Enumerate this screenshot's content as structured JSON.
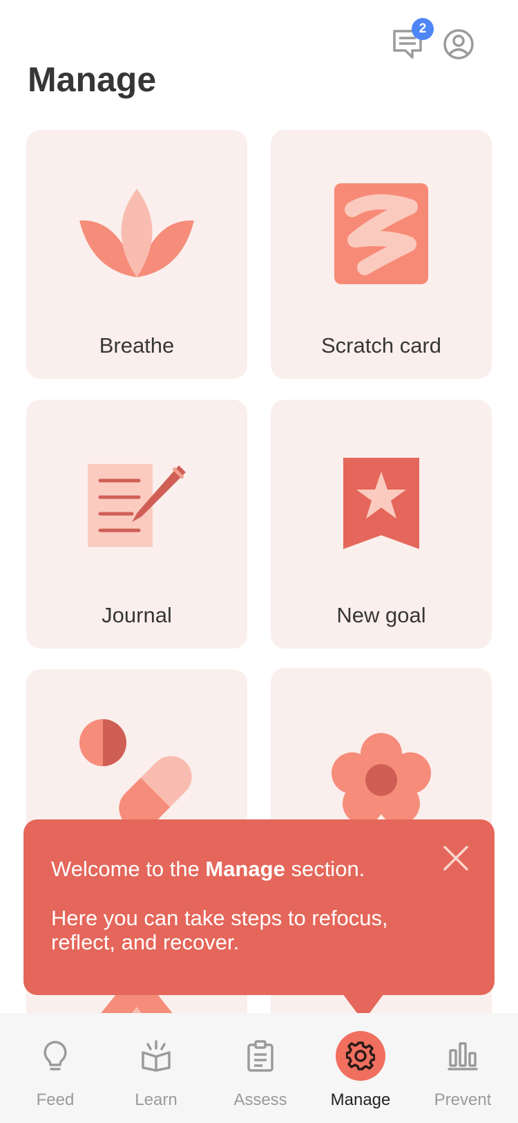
{
  "header": {
    "title": "Manage",
    "messages_badge": "2"
  },
  "cards": [
    {
      "label": "Breathe",
      "icon": "lotus-icon"
    },
    {
      "label": "Scratch card",
      "icon": "scribble-icon"
    },
    {
      "label": "Journal",
      "icon": "journal-icon"
    },
    {
      "label": "New goal",
      "icon": "goal-bookmark-icon"
    },
    {
      "label": "",
      "icon": "medication-icon"
    },
    {
      "label": "",
      "icon": "flower-icon"
    }
  ],
  "toast": {
    "line1_prefix": "Welcome to the ",
    "line1_bold": "Manage",
    "line1_suffix": " section.",
    "line2": "Here you can take steps to refocus, reflect, and recover."
  },
  "nav": [
    {
      "label": "Feed",
      "icon": "lightbulb-icon",
      "active": false
    },
    {
      "label": "Learn",
      "icon": "open-book-icon",
      "active": false
    },
    {
      "label": "Assess",
      "icon": "clipboard-icon",
      "active": false
    },
    {
      "label": "Manage",
      "icon": "gear-icon",
      "active": true
    },
    {
      "label": "Prevent",
      "icon": "bar-chart-icon",
      "active": false
    }
  ],
  "colors": {
    "accent": "#e5665a",
    "card_bg": "#faefec",
    "badge": "#4f86f7",
    "nav_active": "#f06f5f"
  }
}
